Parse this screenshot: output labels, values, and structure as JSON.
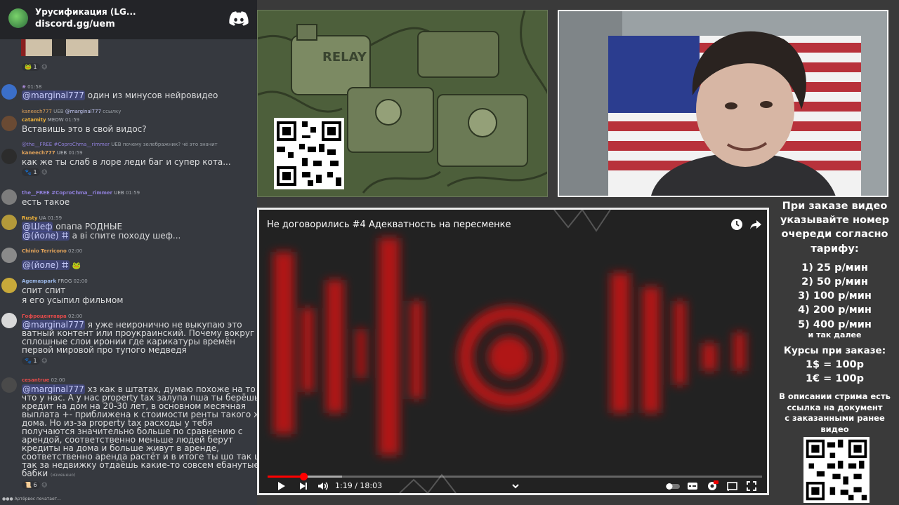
{
  "chat": {
    "server_name": "Урусификация (LG...",
    "server_invite": "discord.gg/uem",
    "messages": [
      {
        "time": "01:58",
        "body_mention": "@marginal777",
        "body_text": " один из минусов нейровидео"
      },
      {
        "reply_user": "kaneech777",
        "reply_tag": "UEB",
        "reply_mention": "@marginal777",
        "reply_text": "ссылку",
        "user": "catamity",
        "tag": "MEOW",
        "time": "01:59",
        "lines": [
          "Вставишь это в свой видос?"
        ]
      },
      {
        "reply_user": "@the__FREE #CoproChma__rimmer",
        "reply_tag": "UEB",
        "reply_text": "почему зелебражник? чё это значит",
        "user": "kaneech777",
        "tag": "UEB",
        "time": "01:59",
        "lines": [
          "как же ты слаб в лоре леди баг и супер кота..."
        ],
        "reaction_count": "1"
      },
      {
        "user": "the__FREE #CoproChma__rimmer",
        "tag": "UEB",
        "time": "01:59",
        "lines": [
          "есть такое"
        ]
      },
      {
        "user": "Rusty",
        "tag": "UA",
        "time": "01:59",
        "line1_mention": "@Шеф",
        "line1_text": " опапа РОДНЫЕ",
        "line2_mention": "@(йоле) ꖛ",
        "line2_text": " а ві спите походу шеф..."
      },
      {
        "user": "Chinio Terricono",
        "time": "02:00",
        "body_mention": "@(йоле) ꖛ"
      },
      {
        "user": "Agemaspark",
        "tag": "FROG",
        "time": "02:00",
        "lines": [
          "спит спит",
          "я его усыпил фильмом"
        ]
      },
      {
        "user": "Гофроцентавра",
        "time": "02:00",
        "body_mention": "@marginal777",
        "line1_text": " я уже неиронично не выкупаю это",
        "lines": [
          "ватный контент или проукраинский. Почему вокруг",
          "сплошные слои иронии где карикатуры времён",
          "первой мировой про тупого медведя"
        ],
        "reaction_count": "1"
      },
      {
        "user": "cesantrue",
        "time": "02:00",
        "body_mention": "@marginal777",
        "line1_text": " хз как в штатах, думаю похоже на то",
        "lines": [
          "что у нас. А у нас property tax залупа пша ты берёшь",
          "кредит на дом на 20-30 лет, в основном месячная",
          "выплата +- приближена к стоимости ренты такого же",
          "дома. Но из-за property tax расходы у тебя",
          "получаются значительно больше по сравнению с",
          "арендой, соответственно меньше людей берут",
          "кредиты на дома и больше живут в аренде,",
          "соответственно аренда растёт и в итоге ты шо так шо",
          "так за недвижку отдаёшь какие-то совсем ебанутые",
          "бабки"
        ],
        "edited": "(изменено)",
        "reaction_count": "6"
      }
    ],
    "first_reaction_count": "1",
    "typing": "Артёрвос печатает..."
  },
  "relay_image": {
    "label": "RELAY"
  },
  "player": {
    "title": "Не договорились #4 Адекватность на пересменке",
    "time_display": "1:19 / 18:03",
    "progress": 0.073,
    "buffered": 0.15
  },
  "info": {
    "order_text": [
      "При заказе видео",
      "указывайте номер",
      "очереди согласно",
      "тарифу:"
    ],
    "tariffs": [
      "1) 25 р/мин",
      "2) 50 р/мин",
      "3) 100 р/мин",
      "4) 200 р/мин",
      "5) 400 р/мин"
    ],
    "and_more": "и так далее",
    "rates_title": "Курсы при заказе:",
    "rates": [
      "1$ = 100р",
      "1€ = 100р"
    ],
    "description_text": [
      "В описании стрима есть",
      "ссылка на документ",
      "с заказанными ранее",
      "видео"
    ]
  },
  "colors": {
    "chat_bg": "#36393f",
    "mention_bg": "#5865f2",
    "progress": "#ff0000",
    "page_bg": "#3a3a3a"
  }
}
